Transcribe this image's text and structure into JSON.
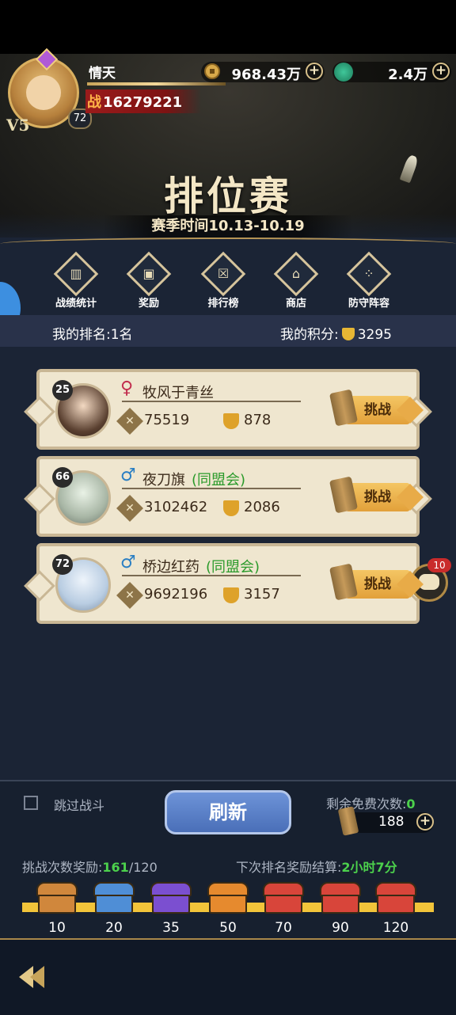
{
  "header": {
    "player_name": "情天",
    "power_prefix": "战",
    "power_value": "16279221",
    "vip_label": "V5",
    "level": "72",
    "coins": "968.43万",
    "jade": "2.4万",
    "plus": "+"
  },
  "banner": {
    "title": "排位赛",
    "season": "赛季时间10.13-10.19"
  },
  "menu": [
    {
      "label": "战绩统计",
      "icon": "chart-icon"
    },
    {
      "label": "奖励",
      "icon": "gift-icon"
    },
    {
      "label": "排行榜",
      "icon": "ranking-icon"
    },
    {
      "label": "商店",
      "icon": "shop-icon"
    },
    {
      "label": "防守阵容",
      "icon": "formation-icon"
    }
  ],
  "my_status": {
    "rank_label": "我的排名:",
    "rank_value": "1名",
    "score_label": "我的积分:",
    "score_value": "3295"
  },
  "opponents": [
    {
      "level": "25",
      "gender": "♀",
      "name": "牧风于青丝",
      "guild": "",
      "power": "75519",
      "score": "878",
      "button": "挑战"
    },
    {
      "level": "66",
      "gender": "♂",
      "name": "夜刀旗",
      "guild": "(同盟会)",
      "power": "3102462",
      "score": "2086",
      "button": "挑战"
    },
    {
      "level": "72",
      "gender": "♂",
      "name": "桥边红药",
      "guild": "(同盟会)",
      "power": "9692196",
      "score": "3157",
      "button": "挑战"
    }
  ],
  "chat": {
    "badge": "10"
  },
  "footer": {
    "skip_label": "跳过战斗",
    "refresh_label": "刷新",
    "free_label": "剩余免费次数:",
    "free_value": "0",
    "tickets": "188",
    "reward_label": "挑战次数奖励:",
    "reward_current": "161",
    "reward_total": "/120",
    "next_label": "下次排名奖励结算:",
    "next_value": "2小时7分",
    "milestones": [
      {
        "value": "10",
        "color": "brown"
      },
      {
        "value": "20",
        "color": "blue"
      },
      {
        "value": "35",
        "color": "purple"
      },
      {
        "value": "50",
        "color": "orange"
      },
      {
        "value": "70",
        "color": "red"
      },
      {
        "value": "90",
        "color": "red"
      },
      {
        "value": "120",
        "color": "red"
      }
    ]
  }
}
